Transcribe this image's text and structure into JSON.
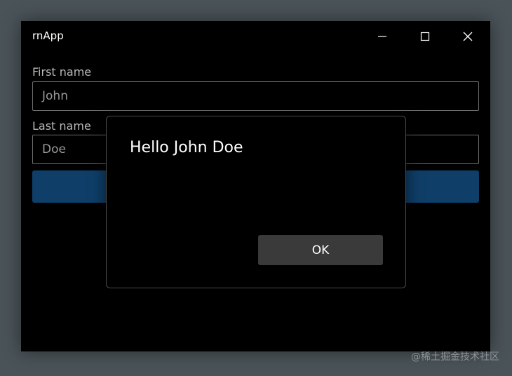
{
  "window": {
    "title": "rnApp"
  },
  "titlebar": {
    "minimize_icon": "minimize-icon",
    "maximize_icon": "maximize-icon",
    "close_icon": "close-icon"
  },
  "form": {
    "first_name_label": "First name",
    "first_name_value": "John",
    "last_name_label": "Last name",
    "last_name_value": "Doe",
    "submit_button_label": ""
  },
  "dialog": {
    "message": "Hello John Doe",
    "ok_label": "OK"
  },
  "watermark": {
    "text": "@稀土掘金技术社区"
  },
  "colors": {
    "desktop_background": "#4a5358",
    "window_background": "#000000",
    "accent_button": "#0f3f69",
    "dialog_button": "#3a3a3a"
  }
}
